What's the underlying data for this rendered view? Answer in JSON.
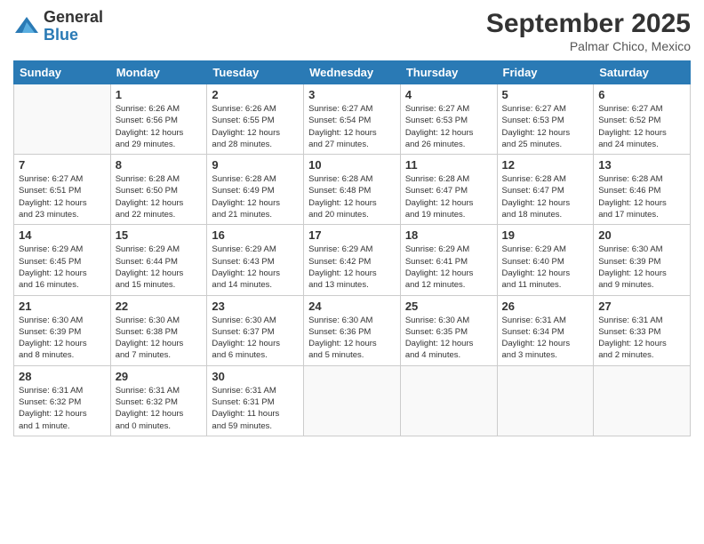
{
  "header": {
    "logo_general": "General",
    "logo_blue": "Blue",
    "month_title": "September 2025",
    "location": "Palmar Chico, Mexico"
  },
  "days_of_week": [
    "Sunday",
    "Monday",
    "Tuesday",
    "Wednesday",
    "Thursday",
    "Friday",
    "Saturday"
  ],
  "weeks": [
    [
      {
        "day": "",
        "info": ""
      },
      {
        "day": "1",
        "info": "Sunrise: 6:26 AM\nSunset: 6:56 PM\nDaylight: 12 hours\nand 29 minutes."
      },
      {
        "day": "2",
        "info": "Sunrise: 6:26 AM\nSunset: 6:55 PM\nDaylight: 12 hours\nand 28 minutes."
      },
      {
        "day": "3",
        "info": "Sunrise: 6:27 AM\nSunset: 6:54 PM\nDaylight: 12 hours\nand 27 minutes."
      },
      {
        "day": "4",
        "info": "Sunrise: 6:27 AM\nSunset: 6:53 PM\nDaylight: 12 hours\nand 26 minutes."
      },
      {
        "day": "5",
        "info": "Sunrise: 6:27 AM\nSunset: 6:53 PM\nDaylight: 12 hours\nand 25 minutes."
      },
      {
        "day": "6",
        "info": "Sunrise: 6:27 AM\nSunset: 6:52 PM\nDaylight: 12 hours\nand 24 minutes."
      }
    ],
    [
      {
        "day": "7",
        "info": "Sunrise: 6:27 AM\nSunset: 6:51 PM\nDaylight: 12 hours\nand 23 minutes."
      },
      {
        "day": "8",
        "info": "Sunrise: 6:28 AM\nSunset: 6:50 PM\nDaylight: 12 hours\nand 22 minutes."
      },
      {
        "day": "9",
        "info": "Sunrise: 6:28 AM\nSunset: 6:49 PM\nDaylight: 12 hours\nand 21 minutes."
      },
      {
        "day": "10",
        "info": "Sunrise: 6:28 AM\nSunset: 6:48 PM\nDaylight: 12 hours\nand 20 minutes."
      },
      {
        "day": "11",
        "info": "Sunrise: 6:28 AM\nSunset: 6:47 PM\nDaylight: 12 hours\nand 19 minutes."
      },
      {
        "day": "12",
        "info": "Sunrise: 6:28 AM\nSunset: 6:47 PM\nDaylight: 12 hours\nand 18 minutes."
      },
      {
        "day": "13",
        "info": "Sunrise: 6:28 AM\nSunset: 6:46 PM\nDaylight: 12 hours\nand 17 minutes."
      }
    ],
    [
      {
        "day": "14",
        "info": "Sunrise: 6:29 AM\nSunset: 6:45 PM\nDaylight: 12 hours\nand 16 minutes."
      },
      {
        "day": "15",
        "info": "Sunrise: 6:29 AM\nSunset: 6:44 PM\nDaylight: 12 hours\nand 15 minutes."
      },
      {
        "day": "16",
        "info": "Sunrise: 6:29 AM\nSunset: 6:43 PM\nDaylight: 12 hours\nand 14 minutes."
      },
      {
        "day": "17",
        "info": "Sunrise: 6:29 AM\nSunset: 6:42 PM\nDaylight: 12 hours\nand 13 minutes."
      },
      {
        "day": "18",
        "info": "Sunrise: 6:29 AM\nSunset: 6:41 PM\nDaylight: 12 hours\nand 12 minutes."
      },
      {
        "day": "19",
        "info": "Sunrise: 6:29 AM\nSunset: 6:40 PM\nDaylight: 12 hours\nand 11 minutes."
      },
      {
        "day": "20",
        "info": "Sunrise: 6:30 AM\nSunset: 6:39 PM\nDaylight: 12 hours\nand 9 minutes."
      }
    ],
    [
      {
        "day": "21",
        "info": "Sunrise: 6:30 AM\nSunset: 6:39 PM\nDaylight: 12 hours\nand 8 minutes."
      },
      {
        "day": "22",
        "info": "Sunrise: 6:30 AM\nSunset: 6:38 PM\nDaylight: 12 hours\nand 7 minutes."
      },
      {
        "day": "23",
        "info": "Sunrise: 6:30 AM\nSunset: 6:37 PM\nDaylight: 12 hours\nand 6 minutes."
      },
      {
        "day": "24",
        "info": "Sunrise: 6:30 AM\nSunset: 6:36 PM\nDaylight: 12 hours\nand 5 minutes."
      },
      {
        "day": "25",
        "info": "Sunrise: 6:30 AM\nSunset: 6:35 PM\nDaylight: 12 hours\nand 4 minutes."
      },
      {
        "day": "26",
        "info": "Sunrise: 6:31 AM\nSunset: 6:34 PM\nDaylight: 12 hours\nand 3 minutes."
      },
      {
        "day": "27",
        "info": "Sunrise: 6:31 AM\nSunset: 6:33 PM\nDaylight: 12 hours\nand 2 minutes."
      }
    ],
    [
      {
        "day": "28",
        "info": "Sunrise: 6:31 AM\nSunset: 6:32 PM\nDaylight: 12 hours\nand 1 minute."
      },
      {
        "day": "29",
        "info": "Sunrise: 6:31 AM\nSunset: 6:32 PM\nDaylight: 12 hours\nand 0 minutes."
      },
      {
        "day": "30",
        "info": "Sunrise: 6:31 AM\nSunset: 6:31 PM\nDaylight: 11 hours\nand 59 minutes."
      },
      {
        "day": "",
        "info": ""
      },
      {
        "day": "",
        "info": ""
      },
      {
        "day": "",
        "info": ""
      },
      {
        "day": "",
        "info": ""
      }
    ]
  ]
}
